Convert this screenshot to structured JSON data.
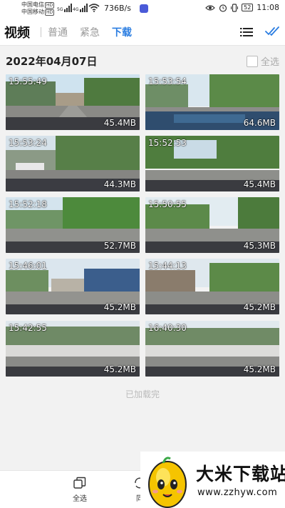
{
  "status_bar": {
    "carrier_1": "中国电信",
    "carrier_2": "中国移动",
    "badge": "HD",
    "signal_1": "5G",
    "signal_2": "4G",
    "net_speed": "736B/s",
    "battery": "52",
    "clock": "11:08"
  },
  "header": {
    "title": "视频",
    "tabs": [
      {
        "label": "普通",
        "active": false
      },
      {
        "label": "紧急",
        "active": false
      },
      {
        "label": "下载",
        "active": true
      }
    ],
    "list_icon": "list-icon",
    "check_icon": "double-check-icon",
    "accent_color": "#2a7de1"
  },
  "date_row": {
    "date": "2022年04月07日",
    "select_all_label": "全选"
  },
  "videos": [
    {
      "time": "15:55:49",
      "size": "45.4MB"
    },
    {
      "time": "15:53:54",
      "size": "64.6MB"
    },
    {
      "time": "15:53:24",
      "size": "44.3MB"
    },
    {
      "time": "15:52:53",
      "size": "45.4MB"
    },
    {
      "time": "15:52:18",
      "size": "52.7MB"
    },
    {
      "time": "15:50:55",
      "size": "45.3MB"
    },
    {
      "time": "15:46:01",
      "size": "45.2MB"
    },
    {
      "time": "15:44:13",
      "size": "45.2MB"
    },
    {
      "time": "15:42:55",
      "size": "45.2MB"
    },
    {
      "time": "16:40:30",
      "size": "45.2MB"
    }
  ],
  "footer_note": "已加载完",
  "bottom_bar": {
    "select_all": "全选",
    "second_label": "同"
  },
  "watermark": {
    "title": "大米下载站",
    "url": "www.zzhyw.com"
  }
}
